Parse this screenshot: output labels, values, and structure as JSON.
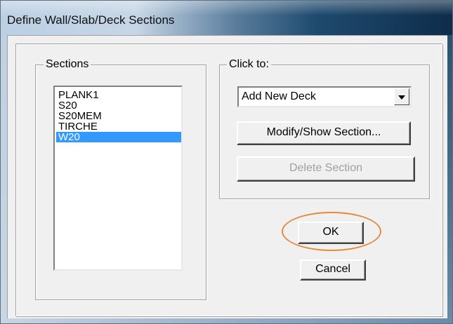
{
  "window": {
    "title": "Define Wall/Slab/Deck Sections"
  },
  "sections": {
    "label": "Sections",
    "items": [
      {
        "label": "PLANK1",
        "selected": false
      },
      {
        "label": "S20",
        "selected": false
      },
      {
        "label": "S20MEM",
        "selected": false
      },
      {
        "label": "TIRCHE",
        "selected": false
      },
      {
        "label": "W20",
        "selected": true
      }
    ]
  },
  "click_to": {
    "label": "Click to:",
    "dropdown_value": "Add New Deck",
    "modify_button": "Modify/Show Section...",
    "delete_button": "Delete Section"
  },
  "buttons": {
    "ok": "OK",
    "cancel": "Cancel"
  },
  "colors": {
    "selection": "#3399ff",
    "annotation": "#e58a3c"
  }
}
